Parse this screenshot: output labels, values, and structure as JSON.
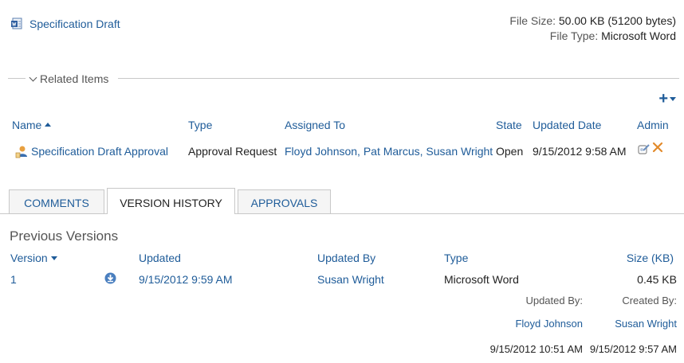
{
  "document": {
    "title": "Specification Draft",
    "file_size_label": "File Size:",
    "file_size_value": "50.00 KB (51200 bytes)",
    "file_type_label": "File Type:",
    "file_type_value": "Microsoft Word"
  },
  "related_items": {
    "section_title": "Related Items",
    "add_label": "+",
    "columns": {
      "name": "Name",
      "type": "Type",
      "assigned_to": "Assigned To",
      "state": "State",
      "updated_date": "Updated Date",
      "admin": "Admin"
    },
    "rows": [
      {
        "name": "Specification Draft Approval",
        "type": "Approval Request",
        "assigned_to": "Floyd Johnson, Pat Marcus, Susan Wright",
        "state": "Open",
        "updated_date": "9/15/2012 9:58 AM"
      }
    ]
  },
  "tabs": [
    {
      "label": "COMMENTS"
    },
    {
      "label": "VERSION HISTORY"
    },
    {
      "label": "APPROVALS"
    }
  ],
  "version_history": {
    "title": "Previous Versions",
    "columns": {
      "version": "Version",
      "updated": "Updated",
      "updated_by": "Updated By",
      "type": "Type",
      "size": "Size (KB)"
    },
    "rows": [
      {
        "version": "1",
        "updated": "9/15/2012 9:59 AM",
        "updated_by": "Susan Wright",
        "type": "Microsoft Word",
        "size": "0.45 KB"
      }
    ],
    "footer": {
      "updated_by_label": "Updated By:",
      "created_by_label": "Created By:",
      "updated_by_name": "Floyd Johnson",
      "created_by_name": "Susan Wright",
      "updated_date": "9/15/2012 10:51 AM",
      "created_date": "9/15/2012 9:57 AM"
    }
  },
  "colors": {
    "link": "#1f5c99",
    "divider": "#c8c8c8",
    "tab_inactive_bg": "#f5f5f5"
  },
  "icons": {
    "document": "word-document-icon",
    "related_row": "approval-person-icon",
    "admin_edit": "edit-icon",
    "admin_delete": "delete-x-icon",
    "download": "download-icon"
  }
}
